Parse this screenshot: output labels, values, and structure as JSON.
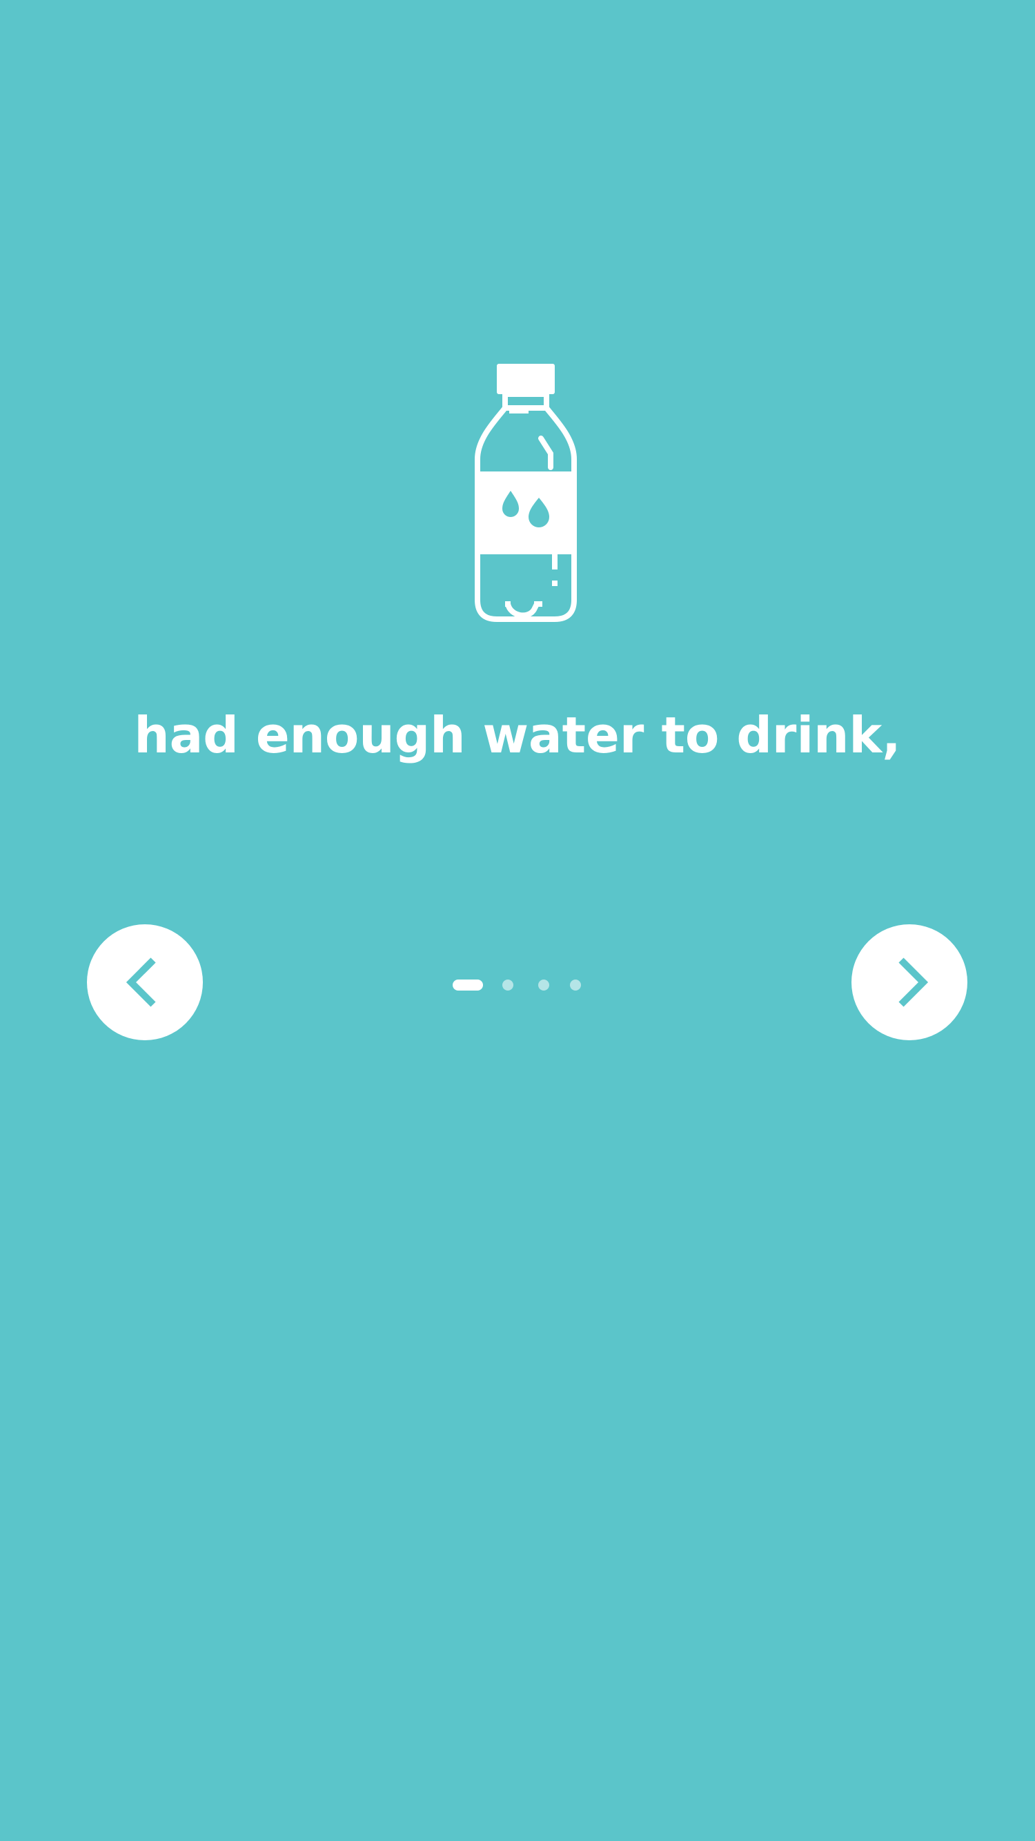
{
  "slide": {
    "message": "had enough water to drink,",
    "icon": "water-bottle-icon"
  },
  "navigation": {
    "prev_icon": "chevron-left-icon",
    "next_icon": "chevron-right-icon"
  },
  "pager": {
    "total": 4,
    "current": 1
  },
  "colors": {
    "background": "#5BC5CA",
    "foreground": "#FFFFFF",
    "dot_inactive": "#A9DFE2"
  }
}
